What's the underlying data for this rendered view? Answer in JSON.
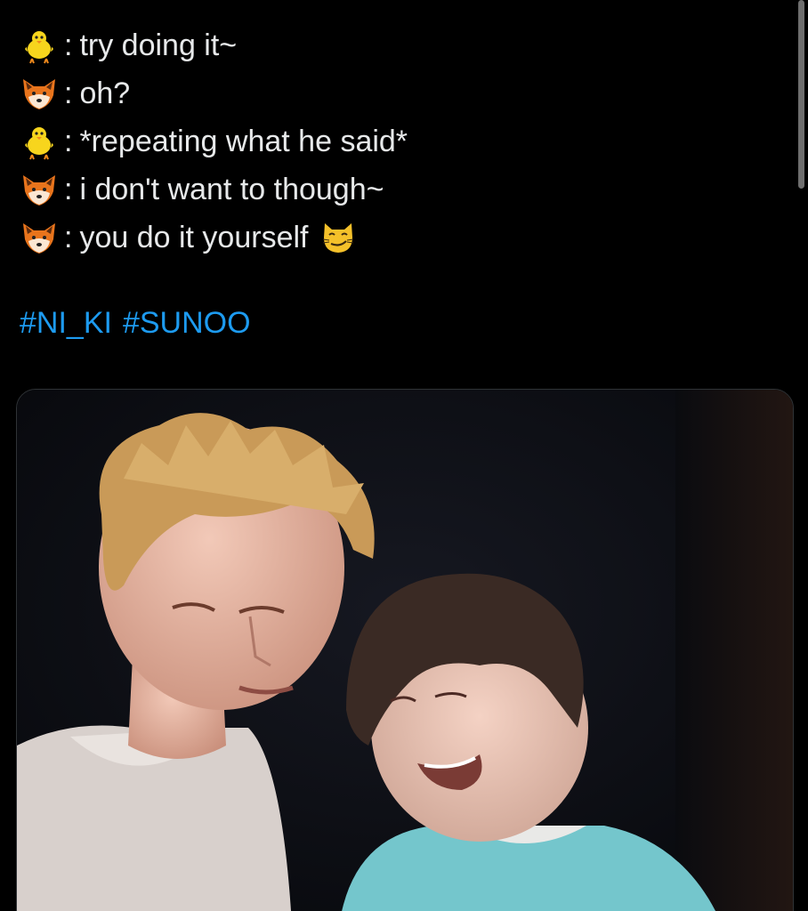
{
  "tweet": {
    "lines": [
      {
        "speaker_icon": "baby-chick-icon",
        "separator": ":",
        "text": "try doing it~"
      },
      {
        "speaker_icon": "fox-face-icon",
        "separator": ":",
        "text": "oh?"
      },
      {
        "speaker_icon": "baby-chick-icon",
        "separator": ":",
        "text": "*repeating what he said*"
      },
      {
        "speaker_icon": "fox-face-icon",
        "separator": ":",
        "text": "i don't want to though~"
      },
      {
        "speaker_icon": "fox-face-icon",
        "separator": ":",
        "text": "you do it yourself",
        "trailing_icon": "smirking-cat-icon"
      }
    ],
    "hashtags": [
      "#NI_KI",
      "#SUNOO"
    ],
    "media": {
      "icon": "photo-of-two-people"
    }
  },
  "colors": {
    "background": "#000000",
    "text": "#e7e9ea",
    "hashtag": "#1d9bf0"
  }
}
